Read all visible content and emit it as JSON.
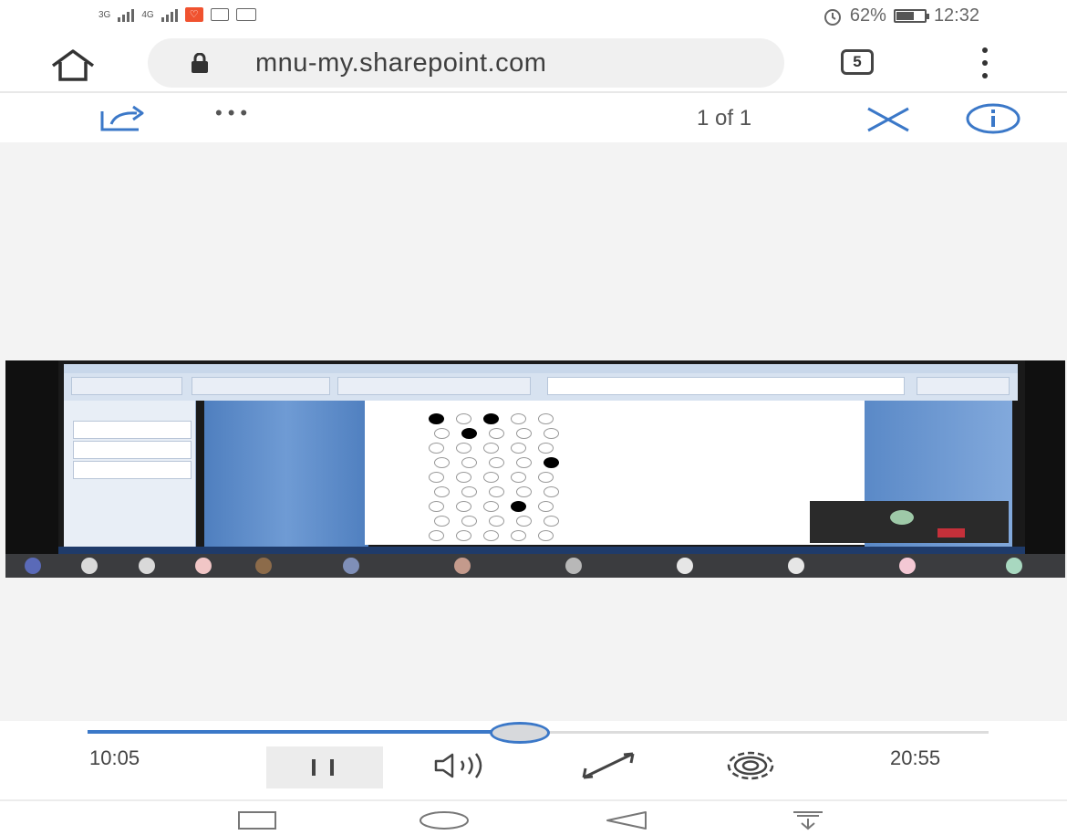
{
  "status_bar": {
    "network_1": "3G",
    "network_2": "4G",
    "battery_text": "62%",
    "battery_level": 0.62,
    "time": "12:32",
    "icons": [
      "signal-icon",
      "signal-icon",
      "notification-app-icon",
      "message-icon",
      "storage-icon",
      "alarm-icon",
      "battery-icon"
    ]
  },
  "browser": {
    "url": "mnu-my.sharepoint.com",
    "tab_count": "5",
    "icons": [
      "home-icon",
      "lock-icon",
      "tabs-icon",
      "menu-dots-icon"
    ]
  },
  "viewer": {
    "more": "•••",
    "page_count": "1 of 1",
    "accent": "#3b78c8",
    "icons": [
      "share-icon",
      "more-icon",
      "close-icon",
      "info-icon"
    ]
  },
  "player": {
    "current_time": "10:05",
    "total_time": "20:55",
    "progress": 0.48,
    "icons": [
      "pause-icon",
      "volume-icon",
      "fullscreen-icon",
      "settings-icon"
    ]
  },
  "nav": {
    "icons": [
      "recents-icon",
      "home-icon",
      "back-icon",
      "notifications-icon"
    ]
  }
}
